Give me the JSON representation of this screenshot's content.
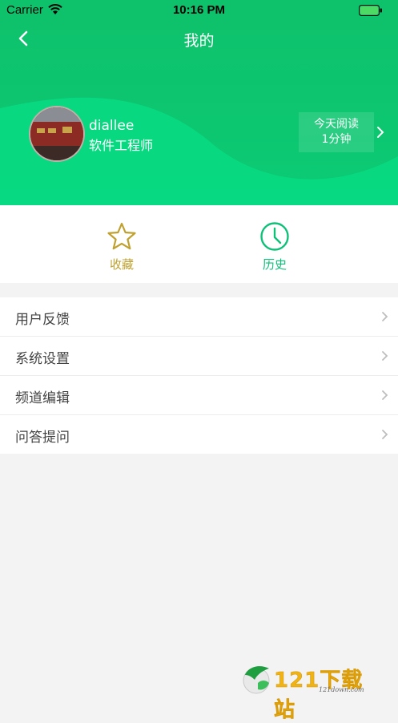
{
  "status_bar": {
    "carrier": "Carrier",
    "time": "10:16 PM"
  },
  "nav": {
    "title": "我的"
  },
  "profile": {
    "username": "diallee",
    "title": "软件工程师",
    "reading_line1": "今天阅读",
    "reading_line2": "1分钟"
  },
  "shortcuts": {
    "favorites": "收藏",
    "history": "历史"
  },
  "menu": [
    {
      "label": "用户反馈"
    },
    {
      "label": "系统设置"
    },
    {
      "label": "频道编辑"
    },
    {
      "label": "问答提问"
    }
  ],
  "watermark": {
    "brand": "121下载站",
    "domain": "121down.com"
  },
  "colors": {
    "header_green": "#0fc46c",
    "favorite_gold": "#c0a12f",
    "history_green": "#0fc078"
  },
  "icons": {
    "back": "chevron-left-icon",
    "favorites": "star-icon",
    "history": "clock-icon",
    "menu_arrow": "chevron-right-icon"
  }
}
